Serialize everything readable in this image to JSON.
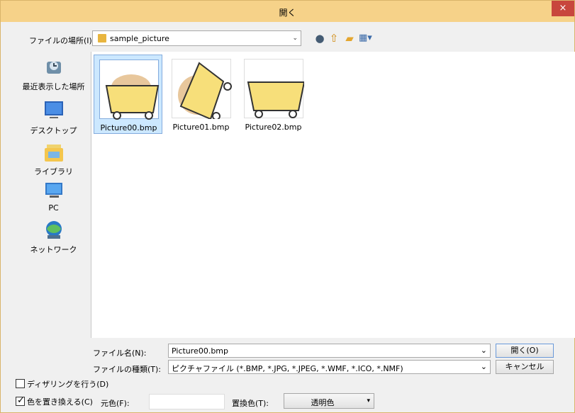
{
  "window": {
    "title": "開く",
    "close_symbol": "×"
  },
  "location": {
    "label": "ファイルの場所(I):",
    "value": "sample_picture"
  },
  "toolbar": {
    "icons": [
      "back-icon",
      "up-folder-icon",
      "new-folder-icon",
      "view-menu-icon"
    ]
  },
  "places": [
    {
      "label": "最近表示した場所",
      "icon": "recent-places-icon"
    },
    {
      "label": "デスクトップ",
      "icon": "desktop-icon"
    },
    {
      "label": "ライブラリ",
      "icon": "library-icon"
    },
    {
      "label": "PC",
      "icon": "pc-icon"
    },
    {
      "label": "ネットワーク",
      "icon": "network-icon"
    }
  ],
  "files": [
    {
      "name": "Picture00.bmp",
      "selected": true
    },
    {
      "name": "Picture01.bmp",
      "selected": false
    },
    {
      "name": "Picture02.bmp",
      "selected": false
    }
  ],
  "form": {
    "filename_label": "ファイル名(N):",
    "filename_value": "Picture00.bmp",
    "filetype_label": "ファイルの種類(T):",
    "filetype_value": "ピクチャファイル (*.BMP, *.JPG, *.JPEG, *.WMF, *.ICO, *.NMF)",
    "open_button": "開く(O)",
    "cancel_button": "キャンセル"
  },
  "options": {
    "dithering_label": "ディザリングを行う(D)",
    "dithering_checked": false,
    "replace_color_label": "色を置き換える(C)",
    "replace_color_checked": true,
    "source_color_label": "元色(F):",
    "replacement_color_label": "置換色(T):",
    "replacement_value": "透明色"
  },
  "colors": {
    "title_bar": "#f6d289",
    "close_button": "#c8463d",
    "selection": "#cce8ff",
    "cart": "#f7df7a"
  }
}
